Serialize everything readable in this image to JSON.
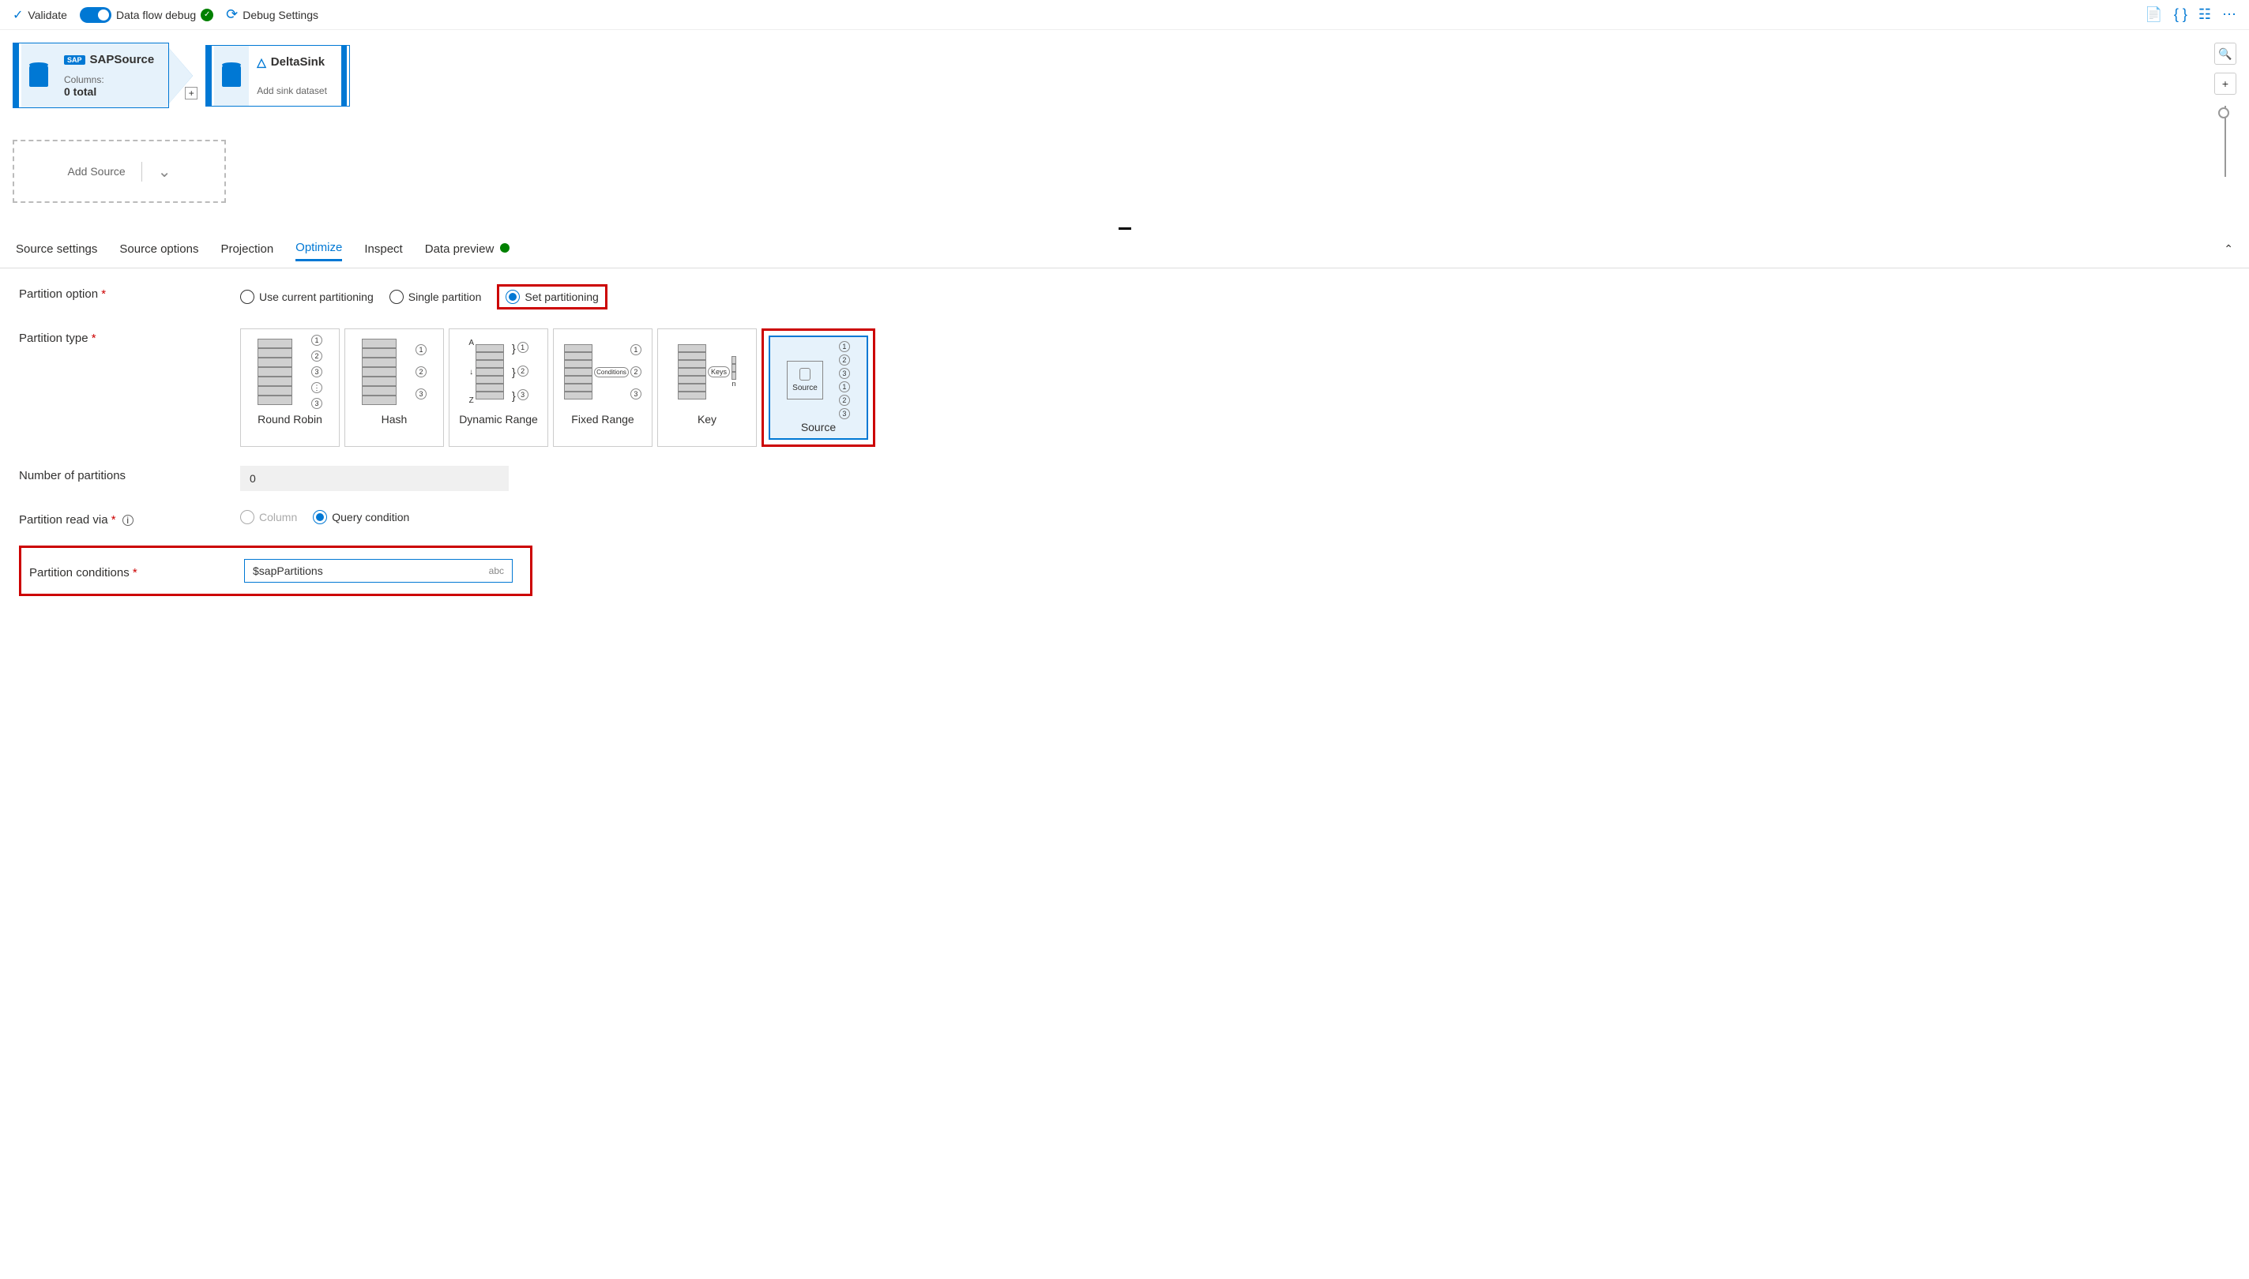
{
  "toolbar": {
    "validate": "Validate",
    "debug_label": "Data flow debug",
    "debug_settings": "Debug Settings"
  },
  "flow": {
    "source": {
      "name": "SAPSource",
      "columns_label": "Columns:",
      "columns_value": "0 total"
    },
    "sink": {
      "name": "DeltaSink",
      "subtitle": "Add sink dataset"
    },
    "add_source": "Add Source"
  },
  "tabs": {
    "source_settings": "Source settings",
    "source_options": "Source options",
    "projection": "Projection",
    "optimize": "Optimize",
    "inspect": "Inspect",
    "data_preview": "Data preview"
  },
  "form": {
    "partition_option_label": "Partition option",
    "use_current": "Use current partitioning",
    "single_partition": "Single partition",
    "set_partitioning": "Set partitioning",
    "partition_type_label": "Partition type",
    "types": {
      "round_robin": "Round Robin",
      "hash": "Hash",
      "dynamic_range": "Dynamic Range",
      "fixed_range": "Fixed Range",
      "key": "Key",
      "source": "Source"
    },
    "num_partitions_label": "Number of partitions",
    "num_partitions_value": "0",
    "partition_read_via_label": "Partition read via",
    "column": "Column",
    "query_condition": "Query condition",
    "partition_conditions_label": "Partition conditions",
    "partition_conditions_value": "$sapPartitions",
    "abc_hint": "abc"
  }
}
